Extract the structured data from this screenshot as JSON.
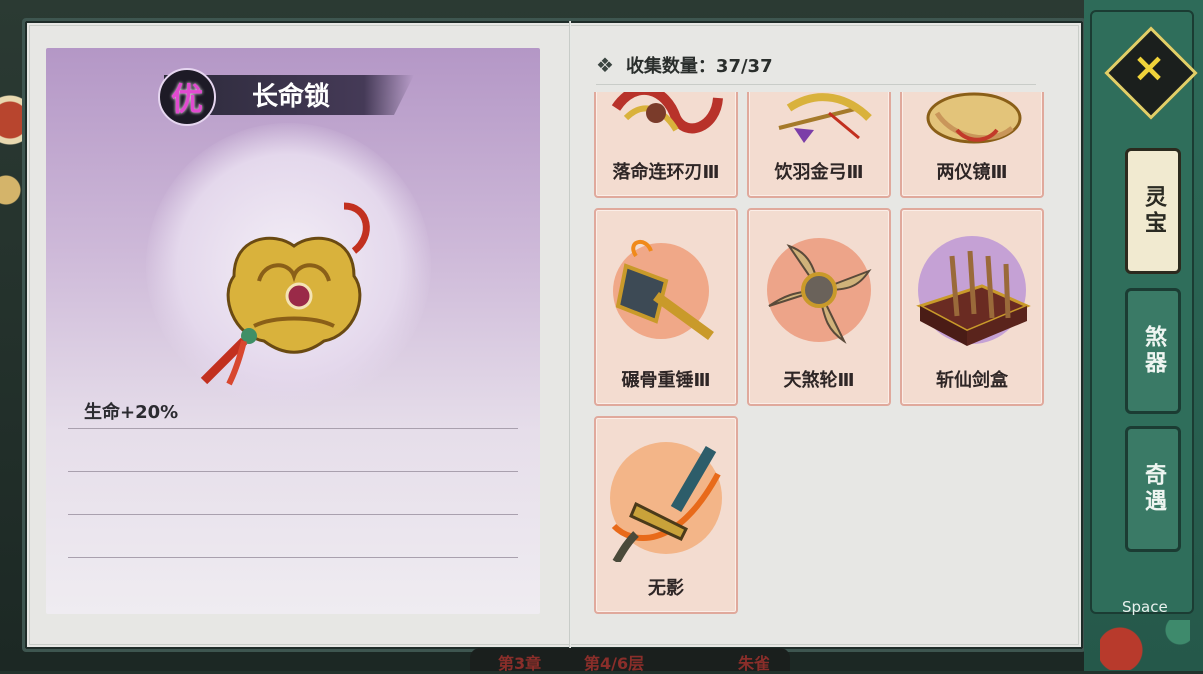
{
  "detail": {
    "rarity": "优",
    "title": "长命锁",
    "stat": "生命+20%"
  },
  "collection": {
    "label": "收集数量：37/37"
  },
  "items": [
    {
      "name": "落命连环刃Ⅲ",
      "icon": "chain-blade-icon"
    },
    {
      "name": "饮羽金弓Ⅲ",
      "icon": "golden-bow-icon"
    },
    {
      "name": "两仪镜Ⅲ",
      "icon": "mirror-icon"
    },
    {
      "name": "碾骨重锤Ⅲ",
      "icon": "hammer-icon"
    },
    {
      "name": "天煞轮Ⅲ",
      "icon": "blade-wheel-icon"
    },
    {
      "name": "斩仙剑盒",
      "icon": "sword-box-icon"
    },
    {
      "name": "无影",
      "icon": "sword-hilt-icon"
    }
  ],
  "tabs": [
    {
      "label": "灵宝",
      "active": true
    },
    {
      "label": "煞器",
      "active": false
    },
    {
      "label": "奇遇",
      "active": false
    }
  ],
  "close_label": "×",
  "space_hint": "Space",
  "bottom": {
    "chapter": "第3章",
    "floor": "第4/6层",
    "extra": "朱雀"
  },
  "colors": {
    "card_bg": "#f3dcd0",
    "card_border": "#e0a99c",
    "side_green": "#2e6b59",
    "rarity_magenta": "#e14ad0"
  }
}
